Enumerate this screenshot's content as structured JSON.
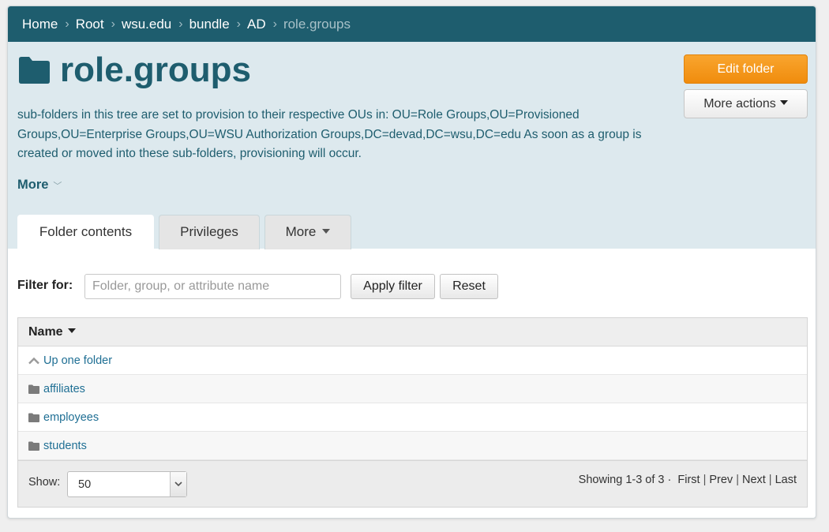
{
  "breadcrumb": {
    "items": [
      "Home",
      "Root",
      "wsu.edu",
      "bundle",
      "AD"
    ],
    "current": "role.groups"
  },
  "header": {
    "title": "role.groups",
    "description": "sub-folders in this tree are set to provision to their respective OUs in: OU=Role Groups,OU=Provisioned Groups,OU=Enterprise Groups,OU=WSU Authorization Groups,DC=devad,DC=wsu,DC=edu As soon as a group is created or moved into these sub-folders, provisioning will occur.",
    "more_label": "More",
    "edit_folder_label": "Edit folder",
    "more_actions_label": "More actions"
  },
  "tabs": [
    {
      "label": "Folder contents",
      "active": true
    },
    {
      "label": "Privileges",
      "active": false
    },
    {
      "label": "More",
      "active": false
    }
  ],
  "filter": {
    "label": "Filter for:",
    "placeholder": "Folder, group, or attribute name",
    "value": "",
    "apply_label": "Apply filter",
    "reset_label": "Reset"
  },
  "table": {
    "column_header": "Name",
    "up_label": "Up one folder",
    "rows": [
      "affiliates",
      "employees",
      "students"
    ]
  },
  "pagination": {
    "show_label": "Show:",
    "page_size": "50",
    "summary": "Showing 1-3 of 3 ·",
    "first": "First",
    "prev": "Prev",
    "next": "Next",
    "last": "Last"
  },
  "colors": {
    "header_bar": "#1e5d6e",
    "header_bg": "#dde9ee",
    "accent_orange": "#f39a1f",
    "link": "#1f6f94"
  }
}
